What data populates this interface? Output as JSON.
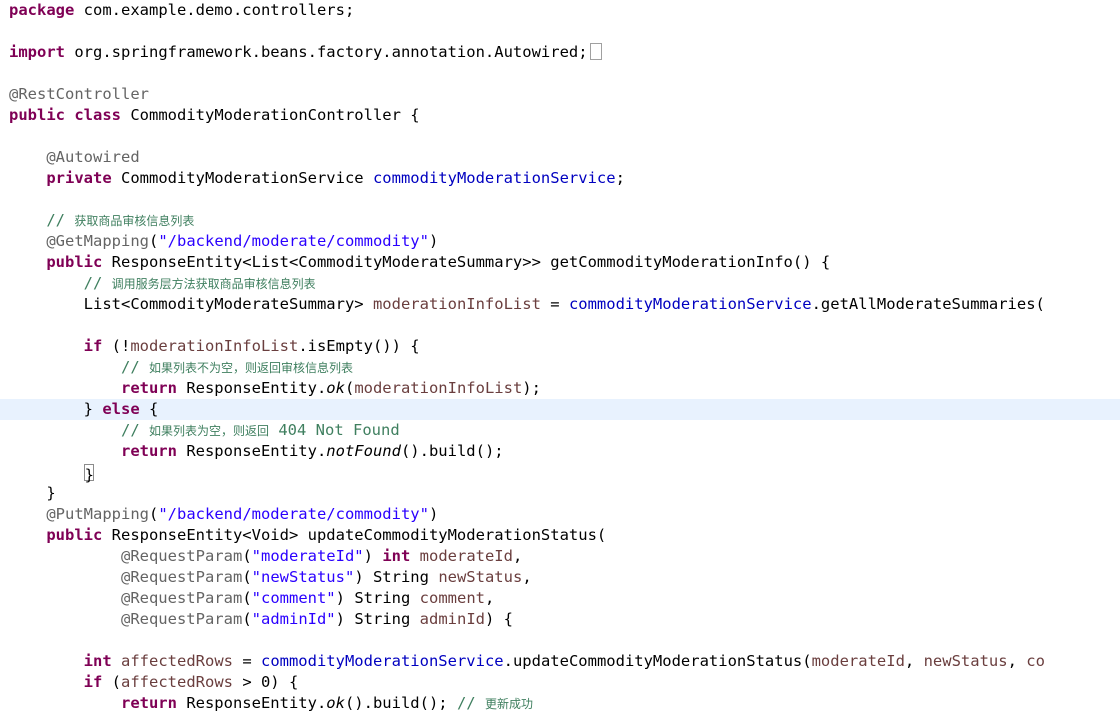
{
  "editor": {
    "fold_marker": "⊖",
    "import_fold_marker": "⊕",
    "lines": {
      "l1": [
        "package",
        " com.example.demo.controllers;"
      ],
      "l3": [
        "import",
        " org.springframework.beans.factory.annotation.Autowired;"
      ],
      "l5": [
        "@RestController"
      ],
      "l6": [
        "public",
        " ",
        "class",
        " CommodityModerationController {"
      ],
      "l8": [
        "    ",
        "@Autowired"
      ],
      "l9": [
        "    ",
        "private",
        " CommodityModerationService ",
        "commodityModerationService",
        ";"
      ],
      "l11": [
        "    ",
        "// ",
        "获取商品审核信息列表"
      ],
      "l12": [
        "    ",
        "@GetMapping",
        "(",
        "\"/backend/moderate/commodity\"",
        ")"
      ],
      "l13": [
        "    ",
        "public",
        " ResponseEntity<List<CommodityModerateSummary>> getCommodityModerationInfo() {"
      ],
      "l14": [
        "        ",
        "// ",
        "调用服务层方法获取商品审核信息列表"
      ],
      "l15": [
        "        ",
        "List<CommodityModerateSummary> ",
        "moderationInfoList",
        " = ",
        "commodityModerationService",
        ".getAllModerateSummaries("
      ],
      "l17": [
        "        ",
        "if",
        " (!",
        "moderationInfoList",
        ".isEmpty()) {"
      ],
      "l18": [
        "            ",
        "// ",
        "如果列表不为空，则返回审核信息列表"
      ],
      "l19": [
        "            ",
        "return",
        " ResponseEntity.",
        "ok",
        "(",
        "moderationInfoList",
        ");"
      ],
      "l20": [
        "        ",
        "} ",
        "else",
        " {"
      ],
      "l21": [
        "            ",
        "// ",
        "如果列表为空，则返回",
        " 404 Not Found"
      ],
      "l22": [
        "            ",
        "return",
        " ResponseEntity.",
        "notFound",
        "().build();"
      ],
      "l23": [
        "        ",
        "}"
      ],
      "l24": [
        "    ",
        "}"
      ],
      "l25": [
        "    ",
        "@PutMapping",
        "(",
        "\"/backend/moderate/commodity\"",
        ")"
      ],
      "l26": [
        "    ",
        "public",
        " ResponseEntity<Void> updateCommodityModerationStatus("
      ],
      "l27": [
        "            ",
        "@RequestParam",
        "(",
        "\"moderateId\"",
        ") ",
        "int",
        " ",
        "moderateId",
        ","
      ],
      "l28": [
        "            ",
        "@RequestParam",
        "(",
        "\"newStatus\"",
        ") String ",
        "newStatus",
        ","
      ],
      "l29": [
        "            ",
        "@RequestParam",
        "(",
        "\"comment\"",
        ") String ",
        "comment",
        ","
      ],
      "l30": [
        "            ",
        "@RequestParam",
        "(",
        "\"adminId\"",
        ") String ",
        "adminId",
        ") {"
      ],
      "l32": [
        "        ",
        "int",
        " ",
        "affectedRows",
        " = ",
        "commodityModerationService",
        ".updateCommodityModerationStatus(",
        "moderateId",
        ", ",
        "newStatus",
        ", ",
        "co"
      ],
      "l33": [
        "        ",
        "if",
        " (",
        "affectedRows",
        " > 0) {"
      ],
      "l34": [
        "            ",
        "return",
        " ResponseEntity.",
        "ok",
        "().build(); ",
        "// ",
        "更新成功"
      ]
    }
  }
}
